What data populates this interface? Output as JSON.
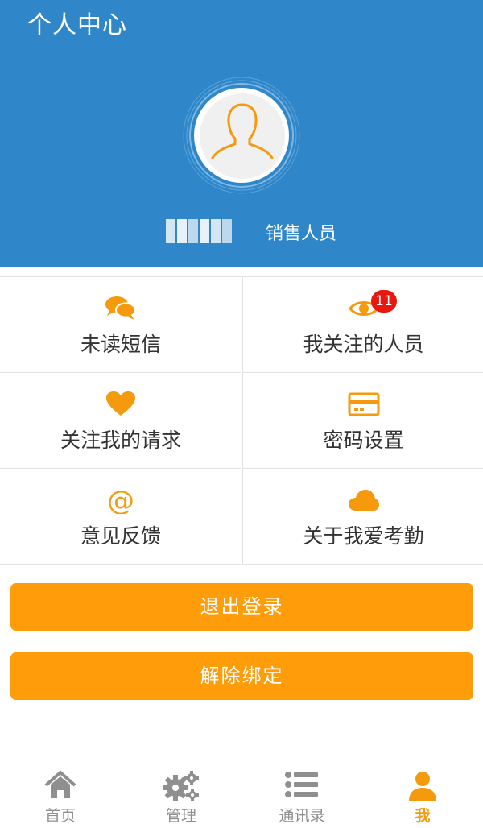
{
  "header": {
    "title": "个人中心",
    "user_role": "销售人员"
  },
  "colors": {
    "header_bg": "#2f87c9",
    "accent": "#ff9c0a",
    "badge": "#e8170f",
    "tab_inactive": "#8f8f8f"
  },
  "menu": [
    {
      "label": "未读短信",
      "icon": "chat-bubbles-icon"
    },
    {
      "label": "我关注的人员",
      "icon": "eye-icon",
      "badge": "11"
    },
    {
      "label": "关注我的请求",
      "icon": "heart-icon"
    },
    {
      "label": "密码设置",
      "icon": "card-icon"
    },
    {
      "label": "意见反馈",
      "icon": "at-sign-icon"
    },
    {
      "label": "关于我爱考勤",
      "icon": "cloud-icon"
    }
  ],
  "buttons": {
    "logout": "退出登录",
    "unbind": "解除绑定"
  },
  "tabs": [
    {
      "label": "首页",
      "icon": "home-icon"
    },
    {
      "label": "管理",
      "icon": "gears-icon"
    },
    {
      "label": "通讯录",
      "icon": "list-icon"
    },
    {
      "label": "我",
      "icon": "person-icon",
      "active": true
    }
  ]
}
